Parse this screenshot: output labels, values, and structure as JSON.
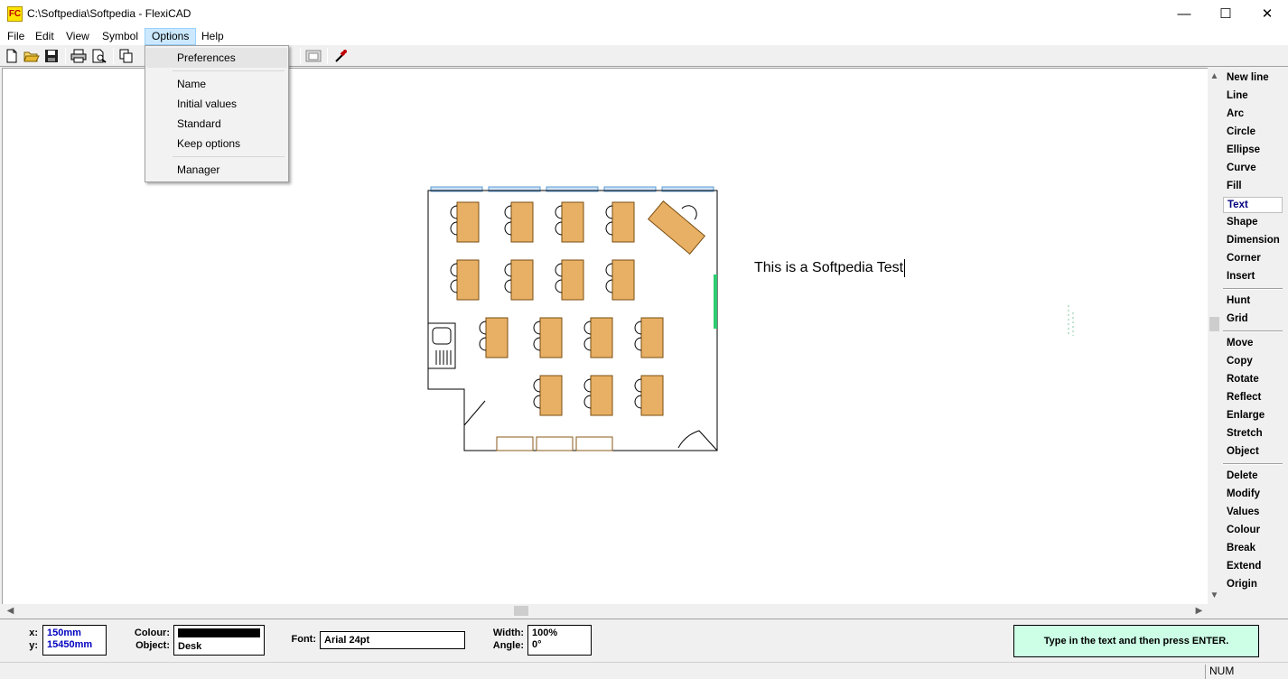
{
  "window": {
    "title": "C:\\Softpedia\\Softpedia - FlexiCAD",
    "app_icon_text": "FC",
    "minimize": "—",
    "maximize": "☐",
    "close": "✕"
  },
  "menubar": {
    "items": [
      {
        "label": "File"
      },
      {
        "label": "Edit"
      },
      {
        "label": "View"
      },
      {
        "label": "Symbol"
      },
      {
        "label": "Options",
        "active": true
      },
      {
        "label": "Help"
      }
    ]
  },
  "options_menu": {
    "items": [
      "Preferences",
      "Name",
      "Initial values",
      "Standard",
      "Keep options",
      "Manager"
    ]
  },
  "toolbar": {
    "icons": [
      "new-file-icon",
      "open-folder-icon",
      "save-icon",
      "print-icon",
      "print-preview-icon",
      "copy-icon",
      "window-icon",
      "eyedropper-icon"
    ]
  },
  "canvas": {
    "text_object": "This is a Softpedia Test"
  },
  "commands": {
    "group1": [
      "New line",
      "Line",
      "Arc",
      "Circle",
      "Ellipse",
      "Curve",
      "Fill",
      "Text",
      "Shape",
      "Dimension",
      "Corner",
      "Insert"
    ],
    "group2": [
      "Hunt",
      "Grid"
    ],
    "group3": [
      "Move",
      "Copy",
      "Rotate",
      "Reflect",
      "Enlarge",
      "Stretch",
      "Object"
    ],
    "group4": [
      "Delete",
      "Modify",
      "Values",
      "Colour",
      "Break",
      "Extend",
      "Origin"
    ],
    "selected": "Text"
  },
  "info": {
    "x_label": "x:",
    "x_value": "150mm",
    "y_label": "y:",
    "y_value": "15450mm",
    "colour_label": "Colour:",
    "colour_value": "#000000",
    "object_label": "Object:",
    "object_value": "Desk",
    "font_label": "Font:",
    "font_value": "Arial 24pt",
    "width_label": "Width:",
    "width_value": "100%",
    "angle_label": "Angle:",
    "angle_value": "0°",
    "prompt": "Type in the text and then press ENTER."
  },
  "status": {
    "num": "NUM"
  },
  "colors": {
    "desk": "#e8b064",
    "window_blue": "#5b9bd5",
    "green_door": "#2ecc71",
    "prompt_bg": "#ccffe6",
    "selected_cmd": "#000080"
  }
}
